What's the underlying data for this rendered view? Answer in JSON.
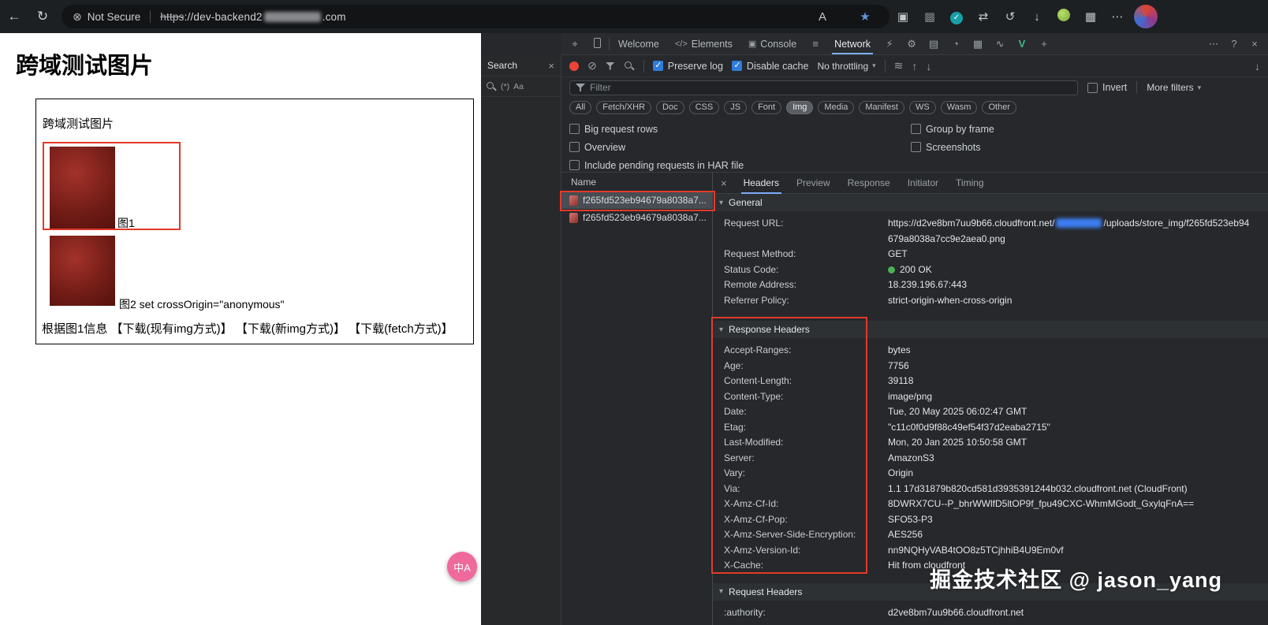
{
  "colors": {
    "accent_blue": "#7cacf8",
    "status_green": "#4cb050",
    "annotation_red": "#e13a2b",
    "checkbox_blue": "#2f7ddb"
  },
  "glyphs": {
    "back": "←",
    "refresh": "↻",
    "not_secure": "⊗",
    "read_aloud": "A",
    "star": "★",
    "screenshot": "▣",
    "extension": "▩",
    "check": "✓",
    "translate": "⇄",
    "history": "↺",
    "down": "↓",
    "up": "↑",
    "grid": "▦",
    "more": "⋯",
    "inspect": "⌖",
    "elements": "</>",
    "console": "▣",
    "sliders": "≡",
    "perf": "⚡",
    "gear": "⚙",
    "panel_device": "▤",
    "profile": "◔",
    "storage": "▦",
    "activity": "∿",
    "vue": "V",
    "plus": "+",
    "help": "?",
    "close": "×",
    "caret_down": "▾",
    "triangle": "▾",
    "clear": "⊘",
    "signal": "≋"
  },
  "browser": {
    "security_label": "Not Secure",
    "url_scheme": "https",
    "url_rest": "://dev-backend2",
    "url_suffix": ".com"
  },
  "webpage": {
    "heading": "跨域测试图片",
    "box_label": "跨域测试图片",
    "img1_caption": "图1",
    "img2_caption": "图2 set crossOrigin=\"anonymous\"",
    "actions_line": "根据图1信息 【下载(现有img方式)】 【下载(新img方式)】 【下载(fetch方式)】",
    "translate_badge": "中A"
  },
  "devtools": {
    "search_panel": {
      "title": "Search",
      "regex_toggle": "(*)",
      "case_toggle": "Aa"
    },
    "tabs": {
      "welcome": "Welcome",
      "elements": "Elements",
      "console": "Console",
      "network": "Network"
    },
    "toolbar": {
      "preserve_log": "Preserve log",
      "disable_cache": "Disable cache",
      "throttling": "No throttling"
    },
    "filter_row": {
      "placeholder": "Filter",
      "invert": "Invert",
      "more_filters": "More filters"
    },
    "pills": [
      {
        "label": "All",
        "selected": false
      },
      {
        "label": "Fetch/XHR",
        "selected": false
      },
      {
        "label": "Doc",
        "selected": false
      },
      {
        "label": "CSS",
        "selected": false
      },
      {
        "label": "JS",
        "selected": false
      },
      {
        "label": "Font",
        "selected": false
      },
      {
        "label": "Img",
        "selected": true
      },
      {
        "label": "Media",
        "selected": false
      },
      {
        "label": "Manifest",
        "selected": false
      },
      {
        "label": "WS",
        "selected": false
      },
      {
        "label": "Wasm",
        "selected": false
      },
      {
        "label": "Other",
        "selected": false
      }
    ],
    "options": {
      "big_request_rows": "Big request rows",
      "overview": "Overview",
      "include_pending": "Include pending requests in HAR file",
      "group_by_frame": "Group by frame",
      "screenshots": "Screenshots"
    },
    "request_list": {
      "column_header": "Name",
      "rows": [
        {
          "name": "f265fd523eb94679a8038a7...",
          "selected": true
        },
        {
          "name": "f265fd523eb94679a8038a7...",
          "selected": false
        }
      ]
    },
    "detail_tabs": [
      {
        "label": "Headers",
        "active": true
      },
      {
        "label": "Preview",
        "active": false
      },
      {
        "label": "Response",
        "active": false
      },
      {
        "label": "Initiator",
        "active": false
      },
      {
        "label": "Timing",
        "active": false
      }
    ],
    "general": {
      "title": "General",
      "request_url_key": "Request URL:",
      "request_url_prefix": "https://d2ve8bm7uu9b66.cloudfront.net/",
      "request_url_suffix": "/uploads/store_img/f265fd523eb94679a8038a7cc9e2aea0.png",
      "rows": [
        {
          "k": "Request Method:",
          "v": "GET"
        },
        {
          "k": "Status Code:",
          "v": "200 OK",
          "dot": true
        },
        {
          "k": "Remote Address:",
          "v": "18.239.196.67:443"
        },
        {
          "k": "Referrer Policy:",
          "v": "strict-origin-when-cross-origin"
        }
      ]
    },
    "response_headers": {
      "title": "Response Headers",
      "rows": [
        {
          "k": "Accept-Ranges:",
          "v": "bytes"
        },
        {
          "k": "Age:",
          "v": "7756"
        },
        {
          "k": "Content-Length:",
          "v": "39118"
        },
        {
          "k": "Content-Type:",
          "v": "image/png"
        },
        {
          "k": "Date:",
          "v": "Tue, 20 May 2025 06:02:47 GMT"
        },
        {
          "k": "Etag:",
          "v": "\"c11c0f0d9f88c49ef54f37d2eaba2715\""
        },
        {
          "k": "Last-Modified:",
          "v": "Mon, 20 Jan 2025 10:50:58 GMT"
        },
        {
          "k": "Server:",
          "v": "AmazonS3"
        },
        {
          "k": "Vary:",
          "v": "Origin"
        },
        {
          "k": "Via:",
          "v": "1.1 17d31879b820cd581d3935391244b032.cloudfront.net (CloudFront)"
        },
        {
          "k": "X-Amz-Cf-Id:",
          "v": "8DWRX7CU--P_bhrWWlfD5ltOP9f_fpu49CXC-WhmMGodt_GxylqFnA=="
        },
        {
          "k": "X-Amz-Cf-Pop:",
          "v": "SFO53-P3"
        },
        {
          "k": "X-Amz-Server-Side-Encryption:",
          "v": "AES256"
        },
        {
          "k": "X-Amz-Version-Id:",
          "v": "nn9NQHyVAB4tOO8z5TCjhhiB4U9Em0vf"
        },
        {
          "k": "X-Cache:",
          "v": "Hit from cloudfront"
        }
      ]
    },
    "request_headers": {
      "title": "Request Headers",
      "rows": [
        {
          "k": ":authority:",
          "v": "d2ve8bm7uu9b66.cloudfront.net"
        }
      ]
    }
  },
  "watermark": "掘金技术社区 @ jason_yang"
}
